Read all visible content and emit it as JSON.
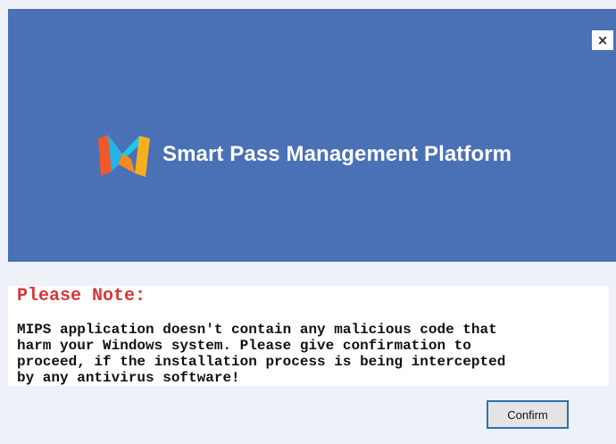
{
  "window": {
    "close_label": "×"
  },
  "banner": {
    "title": "Smart Pass Management Platform",
    "logo_icon": "m-logo-icon",
    "background_color": "#4a70b6"
  },
  "notice": {
    "heading": "Please Note:",
    "body": "MIPS application doesn't contain any malicious code that\nharm your Windows system. Please give confirmation to\nproceed, if the installation process is being intercepted\nby any antivirus software!",
    "heading_color": "#d6373a"
  },
  "actions": {
    "confirm_label": "Confirm"
  }
}
